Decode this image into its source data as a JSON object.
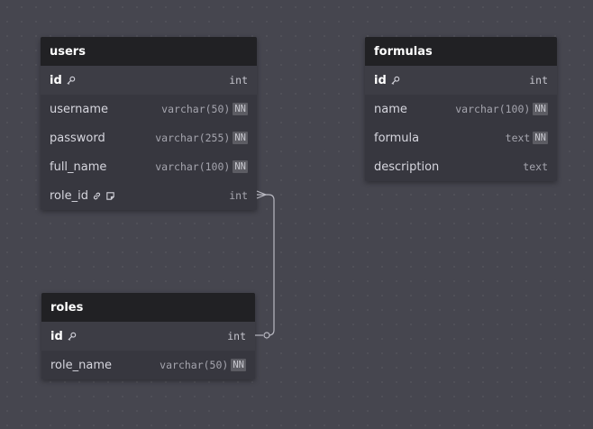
{
  "tables": {
    "users": {
      "name": "users",
      "columns": [
        {
          "name": "id",
          "type": "int",
          "pk": true
        },
        {
          "name": "username",
          "type": "varchar(50)",
          "nn": "NN"
        },
        {
          "name": "password",
          "type": "varchar(255)",
          "nn": "NN"
        },
        {
          "name": "full_name",
          "type": "varchar(100)",
          "nn": "NN"
        },
        {
          "name": "role_id",
          "type": "int",
          "fk": true
        }
      ]
    },
    "formulas": {
      "name": "formulas",
      "columns": [
        {
          "name": "id",
          "type": "int",
          "pk": true
        },
        {
          "name": "name",
          "type": "varchar(100)",
          "nn": "NN"
        },
        {
          "name": "formula",
          "type": "text",
          "nn": "NN"
        },
        {
          "name": "description",
          "type": "text"
        }
      ]
    },
    "roles": {
      "name": "roles",
      "columns": [
        {
          "name": "id",
          "type": "int",
          "pk": true
        },
        {
          "name": "role_name",
          "type": "varchar(50)",
          "nn": "NN"
        }
      ]
    }
  },
  "relationships": [
    {
      "from": "users.role_id",
      "to": "roles.id",
      "from_end": "many",
      "to_end": "one-optional"
    }
  ],
  "colors": {
    "canvas": "#46464f",
    "table_header": "#212124",
    "table_body": "#37373f",
    "connector": "#b9b9c2"
  }
}
